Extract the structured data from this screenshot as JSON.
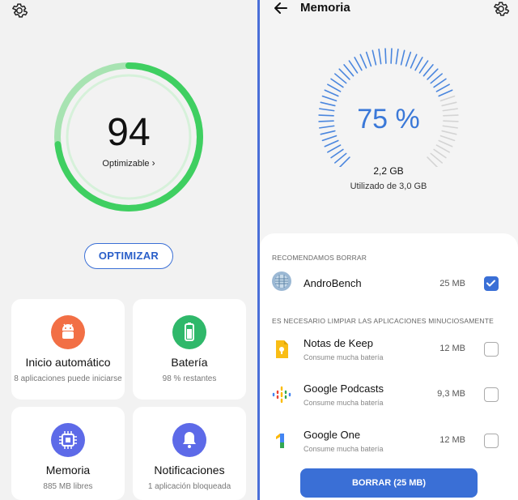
{
  "left": {
    "score": "94",
    "score_sub": "Optimizable",
    "optimize_label": "OPTIMIZAR",
    "score_value": 94,
    "cards": [
      {
        "title": "Inicio automático",
        "sub": "8 aplicaciones puede iniciarse",
        "color": "#f26f45",
        "icon": "android-icon"
      },
      {
        "title": "Batería",
        "sub": "98 % restantes",
        "color": "#2fb86a",
        "icon": "battery-icon"
      },
      {
        "title": "Memoria",
        "sub": "885 MB libres",
        "color": "#5d6ae8",
        "icon": "chip-icon"
      },
      {
        "title": "Notificaciones",
        "sub": "1 aplicación bloqueada",
        "color": "#5d6ae8",
        "icon": "bell-icon"
      }
    ]
  },
  "right": {
    "title": "Memoria",
    "percent": "75 %",
    "percent_value": 75,
    "used": "2,2 GB",
    "of_total": "Utilizado de 3,0 GB",
    "recommend_header": "RECOMENDAMOS BORRAR",
    "clean_header": "ES NECESARIO LIMPIAR LAS APLICACIONES MINUCIOSAMENTE",
    "recommended": [
      {
        "name": "AndroBench",
        "size": "25 MB",
        "checked": true,
        "icon": "androbench-icon"
      }
    ],
    "apps": [
      {
        "name": "Notas de Keep",
        "desc": "Consume mucha batería",
        "size": "12 MB",
        "checked": false,
        "icon": "keep-icon"
      },
      {
        "name": "Google Podcasts",
        "desc": "Consume mucha batería",
        "size": "9,3 MB",
        "checked": false,
        "icon": "podcasts-icon"
      },
      {
        "name": "Google One",
        "desc": "Consume mucha batería",
        "size": "12 MB",
        "checked": false,
        "icon": "google-one-icon"
      }
    ],
    "delete_label": "BORRAR (25 MB)",
    "accent": "#3a6fd6"
  }
}
